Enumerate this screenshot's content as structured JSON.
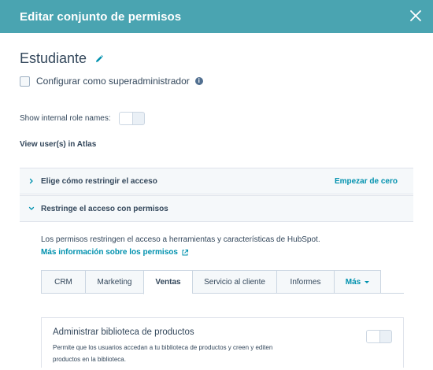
{
  "header": {
    "title": "Editar conjunto de permisos"
  },
  "role": {
    "name": "Estudiante"
  },
  "superadmin": {
    "label": "Configurar como superadministrador",
    "checked": false
  },
  "internal_roles": {
    "label": "Show internal role names:",
    "enabled": false
  },
  "view_users": {
    "label": "View user(s) in Atlas"
  },
  "accordions": [
    {
      "title": "Elige cómo restringir el acceso",
      "action": "Empezar de cero",
      "expanded": false
    },
    {
      "title": "Restringe el acceso con permisos",
      "expanded": true
    }
  ],
  "section": {
    "description": "Los permisos restringen el acceso a herramientas y características de HubSpot.",
    "more_link": "Más información sobre los permisos"
  },
  "tabs": [
    {
      "label": "CRM",
      "active": false
    },
    {
      "label": "Marketing",
      "active": false
    },
    {
      "label": "Ventas",
      "active": true
    },
    {
      "label": "Servicio al cliente",
      "active": false
    },
    {
      "label": "Informes",
      "active": false
    },
    {
      "label": "Más",
      "active": false
    }
  ],
  "permission": {
    "title": "Administrar biblioteca de productos",
    "description": "Permite que los usuarios accedan a tu biblioteca de productos y creen y editen productos en la biblioteca.",
    "enabled": false
  },
  "colors": {
    "header": "#4aa4b1",
    "link": "#0091ae",
    "text": "#33475b"
  }
}
